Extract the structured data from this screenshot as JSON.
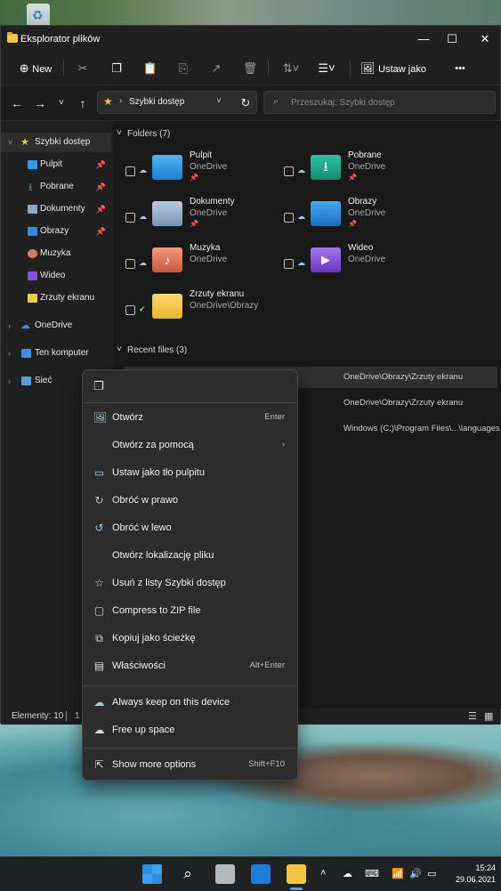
{
  "window": {
    "title": "Eksplorator plików",
    "controls": {
      "minimize": "—",
      "maximize": "☐",
      "close": "✕"
    }
  },
  "toolbar": {
    "new_label": "New",
    "wallpaper_label": "Ustaw jako tło",
    "more_label": "•••"
  },
  "nav": {
    "address_text": "Szybki dostęp",
    "search_placeholder": "Przeszukaj: Szybki dostęp"
  },
  "sidebar": {
    "quick_access": "Szybki dostęp",
    "items": [
      {
        "label": "Pulpit",
        "pinned": true
      },
      {
        "label": "Pobrane",
        "pinned": true
      },
      {
        "label": "Dokumenty",
        "pinned": true
      },
      {
        "label": "Obrazy",
        "pinned": true
      },
      {
        "label": "Muzyka",
        "pinned": false
      },
      {
        "label": "Wideo",
        "pinned": false
      },
      {
        "label": "Zrzuty ekranu",
        "pinned": false
      }
    ],
    "onedrive": "OneDrive",
    "this_pc": "Ten komputer",
    "network": "Sieć"
  },
  "content": {
    "folders_header": "Folders (7)",
    "folders": [
      {
        "name": "Pulpit",
        "location": "OneDrive",
        "pinned": true,
        "color": "#2f9be6"
      },
      {
        "name": "Pobrane",
        "location": "OneDrive",
        "pinned": true,
        "color": "#1fa38a"
      },
      {
        "name": "Dokumenty",
        "location": "OneDrive",
        "pinned": true,
        "color": "#8aa8c8"
      },
      {
        "name": "Obrazy",
        "location": "OneDrive",
        "pinned": true,
        "color": "#2a8de0"
      },
      {
        "name": "Muzyka",
        "location": "OneDrive",
        "pinned": false,
        "color": "#e07a5f"
      },
      {
        "name": "Wideo",
        "location": "OneDrive",
        "pinned": false,
        "color": "#8a4fd6"
      },
      {
        "name": "Zrzuty ekranu",
        "location": "OneDrive\\Obrazy",
        "pinned": false,
        "color": "#f2c94c"
      }
    ],
    "recent_header": "Recent files (3)",
    "recent": [
      {
        "path": "OneDrive\\Obrazy\\Zrzuty ekranu"
      },
      {
        "path": "OneDrive\\Obrazy\\Zrzuty ekranu"
      },
      {
        "path": "Windows (C:)\\Program Files\\...\\languages"
      }
    ]
  },
  "status": {
    "count": "Elementy: 10",
    "selected": "1"
  },
  "context_menu": {
    "items": [
      {
        "label": "Otwórz",
        "accel": "Enter",
        "icon": "image-icon"
      },
      {
        "label": "Otwórz za pomocą",
        "accel": "›",
        "icon": ""
      },
      {
        "label": "Ustaw jako tło pulpitu",
        "accel": "",
        "icon": "wallpaper-icon"
      },
      {
        "label": "Obróć w prawo",
        "accel": "",
        "icon": "rotate-right-icon"
      },
      {
        "label": "Obróć w lewo",
        "accel": "",
        "icon": "rotate-left-icon"
      },
      {
        "label": "Otwórz lokalizację pliku",
        "accel": "",
        "icon": ""
      },
      {
        "label": "Usuń z listy Szybki dostęp",
        "accel": "",
        "icon": "unpin-star-icon"
      },
      {
        "label": "Compress to ZIP file",
        "accel": "",
        "icon": "zip-icon"
      },
      {
        "label": "Kopiuj jako ścieżkę",
        "accel": "",
        "icon": "copy-path-icon"
      },
      {
        "label": "Właściwości",
        "accel": "Alt+Enter",
        "icon": "properties-icon"
      },
      {
        "label": "Always keep on this device",
        "accel": "",
        "icon": "cloud-sync-icon"
      },
      {
        "label": "Free up space",
        "accel": "",
        "icon": "cloud-icon"
      },
      {
        "label": "Show more options",
        "accel": "Shift+F10",
        "icon": "more-options-icon"
      }
    ]
  },
  "taskbar": {
    "time": "15:24",
    "date": "29.06.2021"
  }
}
